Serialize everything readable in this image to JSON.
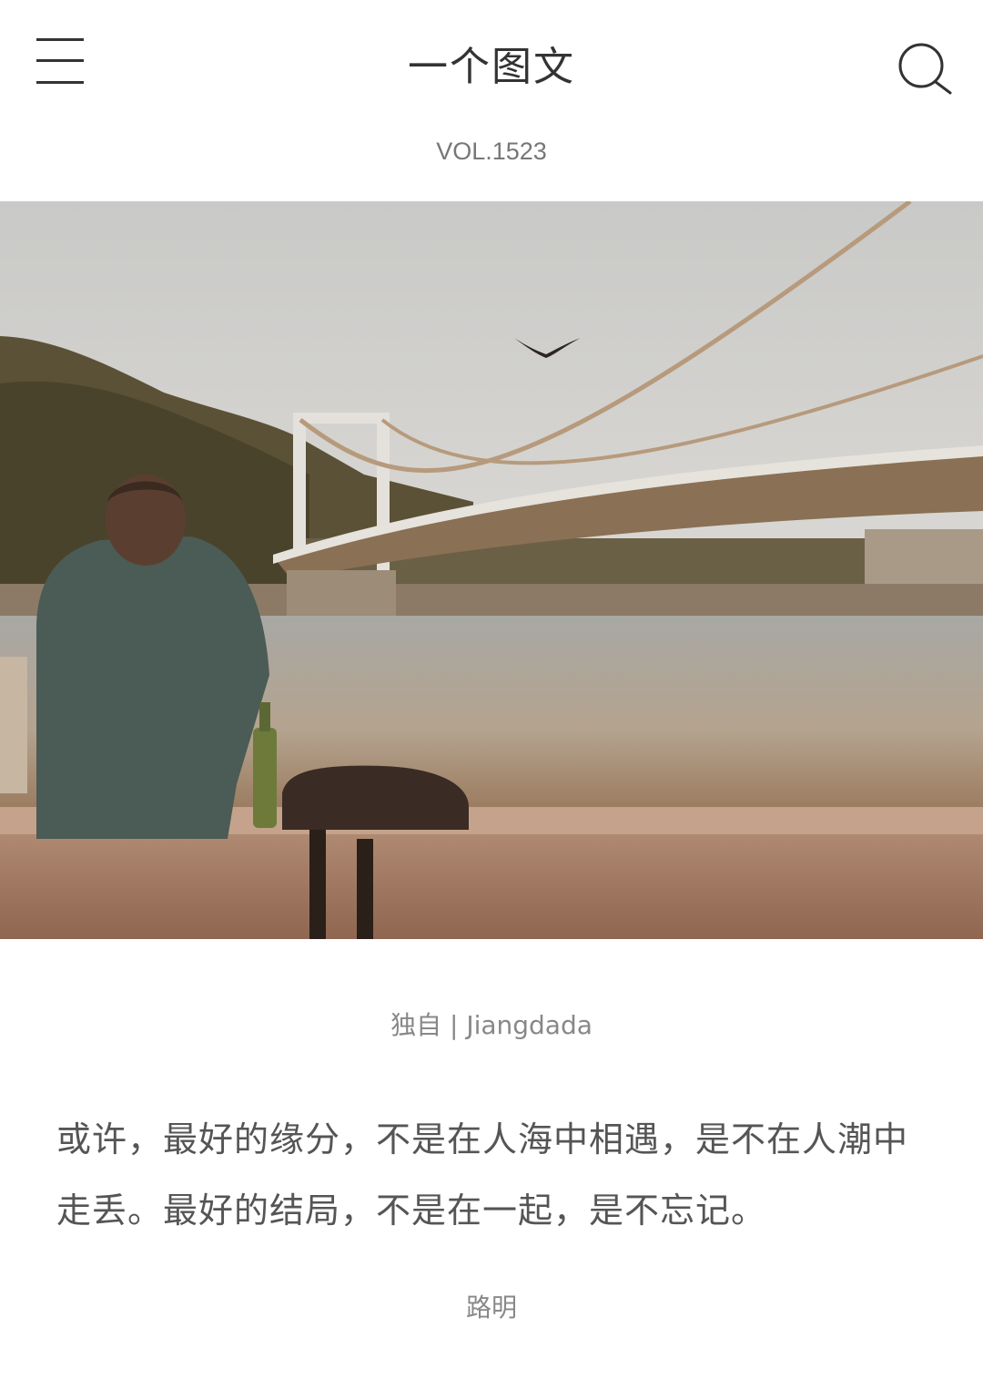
{
  "header": {
    "title": "一个图文",
    "menu_icon": "hamburger-menu-icon",
    "search_icon": "search-icon"
  },
  "issue": {
    "volume": "VOL.1523"
  },
  "photo": {
    "subject": "man-sitting-by-river-bridge",
    "title": "独自",
    "author": "Jiangdada",
    "caption": "独自 | Jiangdada"
  },
  "quote": {
    "text": "或许，最好的缘分，不是在人海中相遇，是不在人潮中走丢。最好的结局，不是在一起，是不忘记。",
    "author": "路明"
  }
}
